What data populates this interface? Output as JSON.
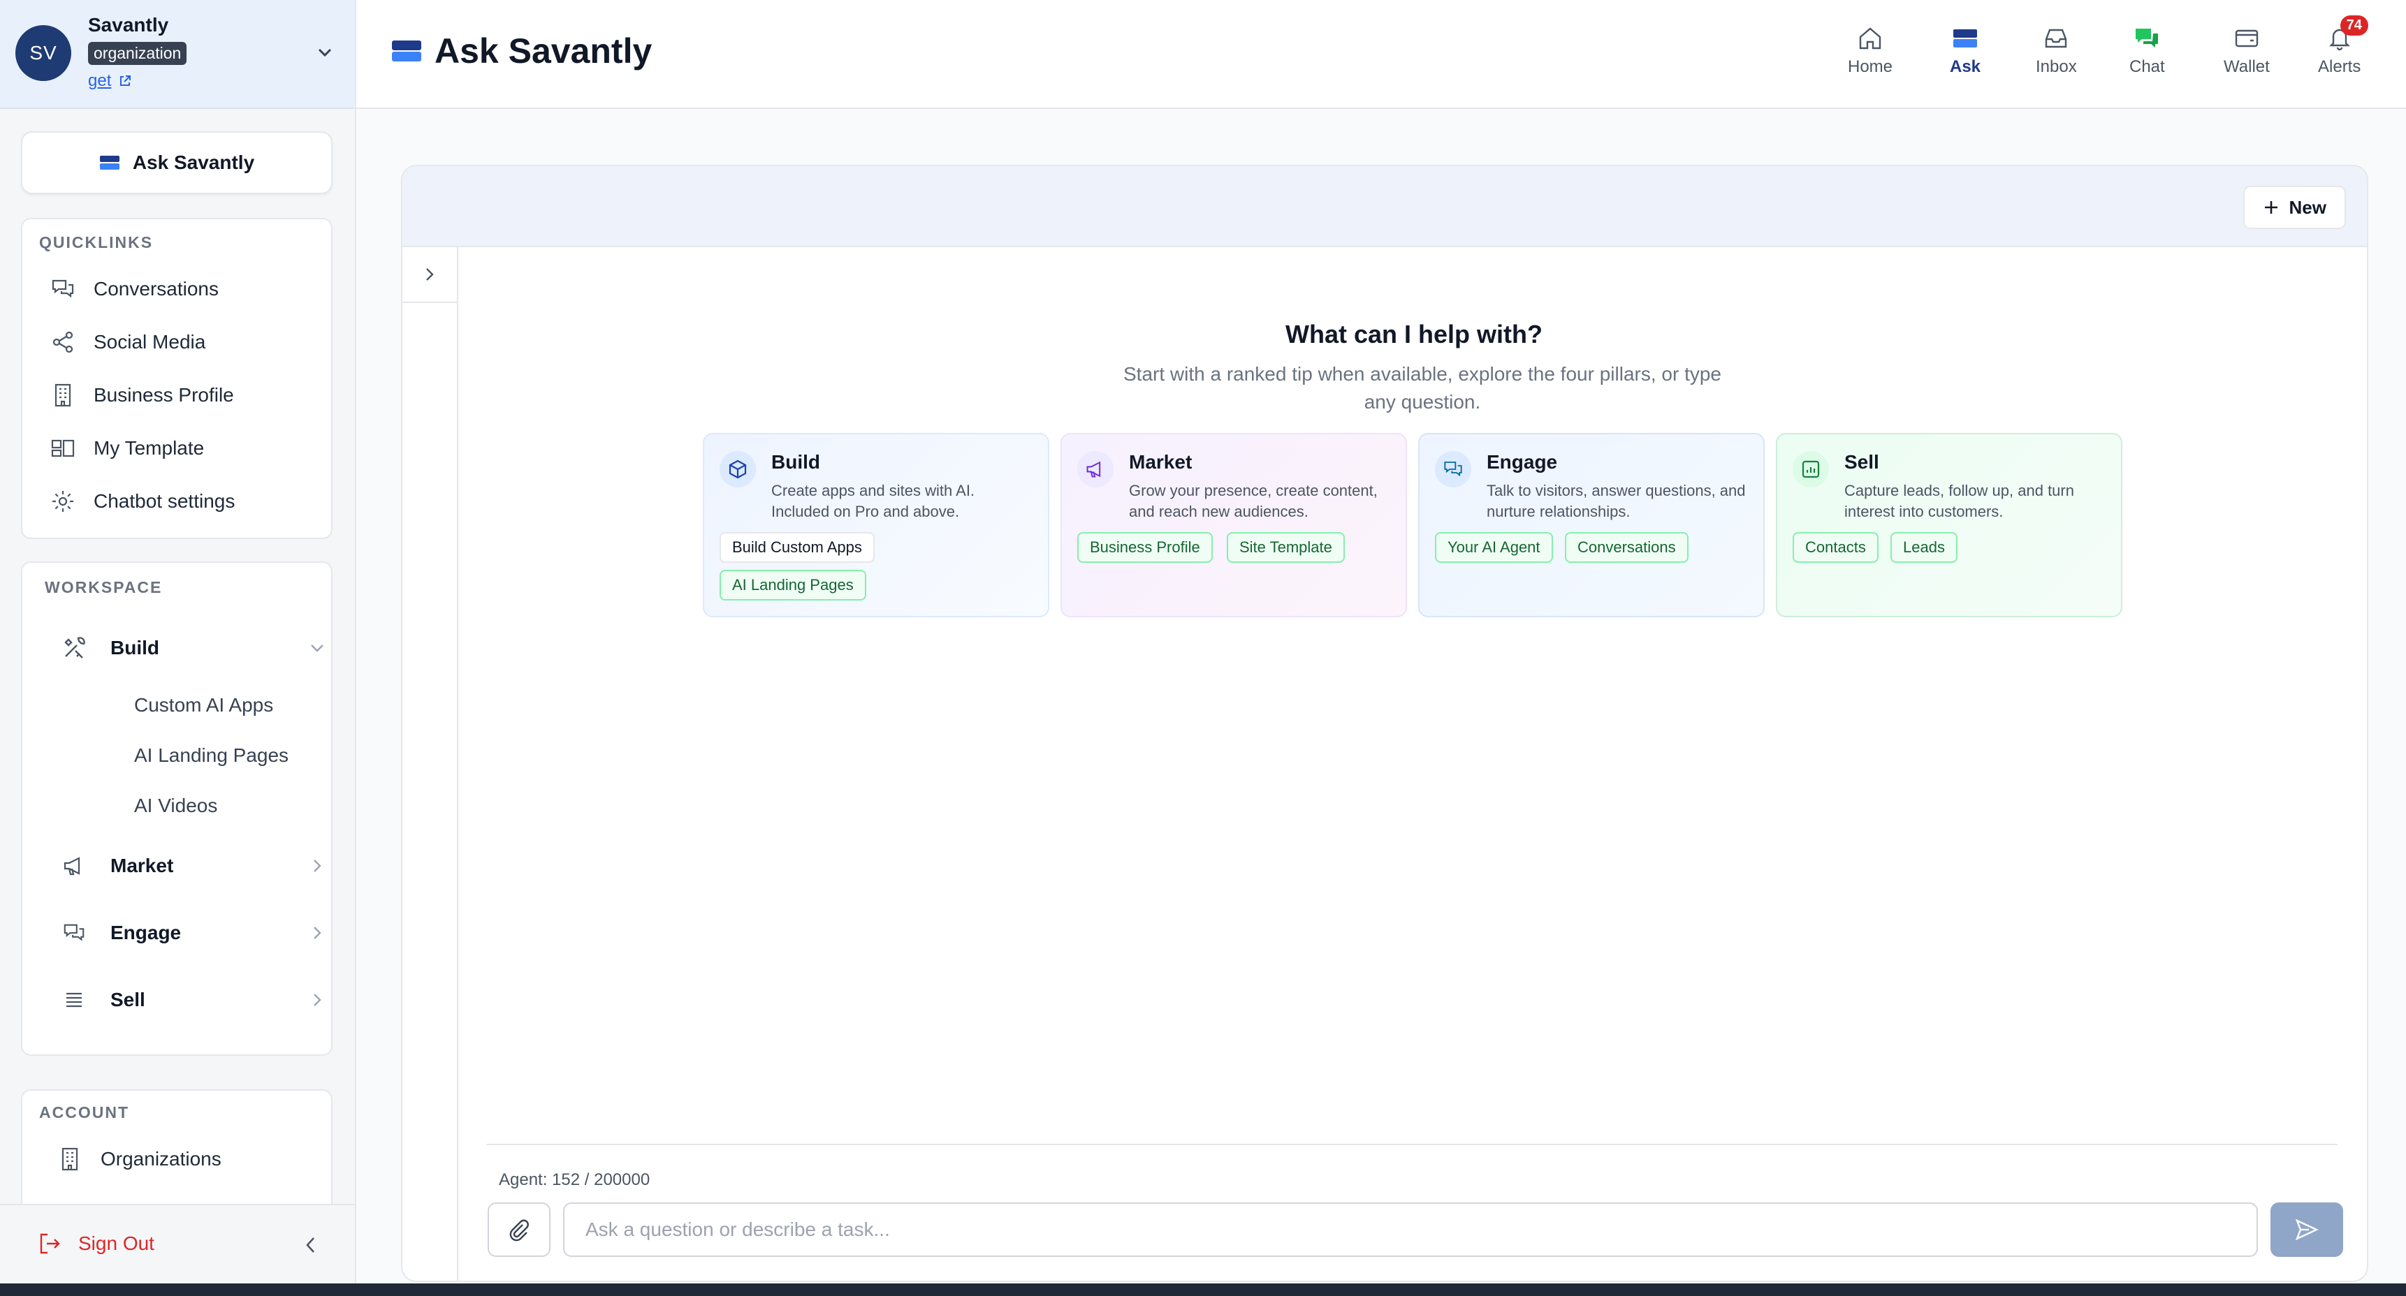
{
  "org": {
    "initials": "SV",
    "name": "Savantly",
    "badge": "organization",
    "link": "get"
  },
  "sidebar": {
    "ask_label": "Ask Savantly",
    "quicklinks_title": "QUICKLINKS",
    "quicklinks": [
      {
        "label": "Conversations",
        "icon": "chat-bubbles-icon"
      },
      {
        "label": "Social Media",
        "icon": "share-icon"
      },
      {
        "label": "Business Profile",
        "icon": "building-icon"
      },
      {
        "label": "My Template",
        "icon": "template-icon"
      },
      {
        "label": "Chatbot settings",
        "icon": "gear-icon"
      }
    ],
    "workspace_title": "WORKSPACE",
    "workspace": [
      {
        "label": "Build",
        "icon": "tools-icon",
        "expanded": true,
        "children": [
          "Custom AI Apps",
          "AI Landing Pages",
          "AI Videos"
        ]
      },
      {
        "label": "Market",
        "icon": "megaphone-icon"
      },
      {
        "label": "Engage",
        "icon": "chat-bubbles-icon"
      },
      {
        "label": "Sell",
        "icon": "list-icon"
      }
    ],
    "account_title": "ACCOUNT",
    "account": [
      {
        "label": "Organizations",
        "icon": "building-icon"
      }
    ],
    "sign_out": "Sign Out"
  },
  "header": {
    "title": "Ask Savantly",
    "nav": [
      {
        "label": "Home",
        "icon": "home-icon"
      },
      {
        "label": "Ask",
        "icon": "ask-icon",
        "active": true
      },
      {
        "label": "Inbox",
        "icon": "inbox-icon"
      },
      {
        "label": "Chat",
        "icon": "chat-icon"
      },
      {
        "label": "Wallet",
        "icon": "wallet-icon"
      },
      {
        "label": "Alerts",
        "icon": "bell-icon",
        "badge": "74"
      }
    ]
  },
  "main": {
    "new_label": "New",
    "title": "What can I help with?",
    "subtitle": "Start with a ranked tip when available, explore the four pillars, or type any question.",
    "pillars": [
      {
        "title": "Build",
        "desc": "Create apps and sites with AI. Included on Pro and above.",
        "chips": [
          "Build Custom Apps",
          "AI Landing Pages"
        ],
        "icon": "cube-icon"
      },
      {
        "title": "Market",
        "desc": "Grow your presence, create content, and reach new audiences.",
        "chips": [
          "Business Profile",
          "Site Template"
        ],
        "icon": "megaphone-icon"
      },
      {
        "title": "Engage",
        "desc": "Talk to visitors, answer questions, and nurture relationships.",
        "chips": [
          "Your AI Agent",
          "Conversations"
        ],
        "icon": "chat-bubbles-icon"
      },
      {
        "title": "Sell",
        "desc": "Capture leads, follow up, and turn interest into customers.",
        "chips": [
          "Contacts",
          "Leads"
        ],
        "icon": "chart-icon"
      }
    ],
    "agent_usage": "Agent: 152 / 200000",
    "input_placeholder": "Ask a question or describe a task...",
    "input_value": ""
  },
  "colors": {
    "accent": "#1e3a8a",
    "sign_out": "#dc2626",
    "alert_badge": "#dc2626",
    "chip_green": "#166534"
  }
}
